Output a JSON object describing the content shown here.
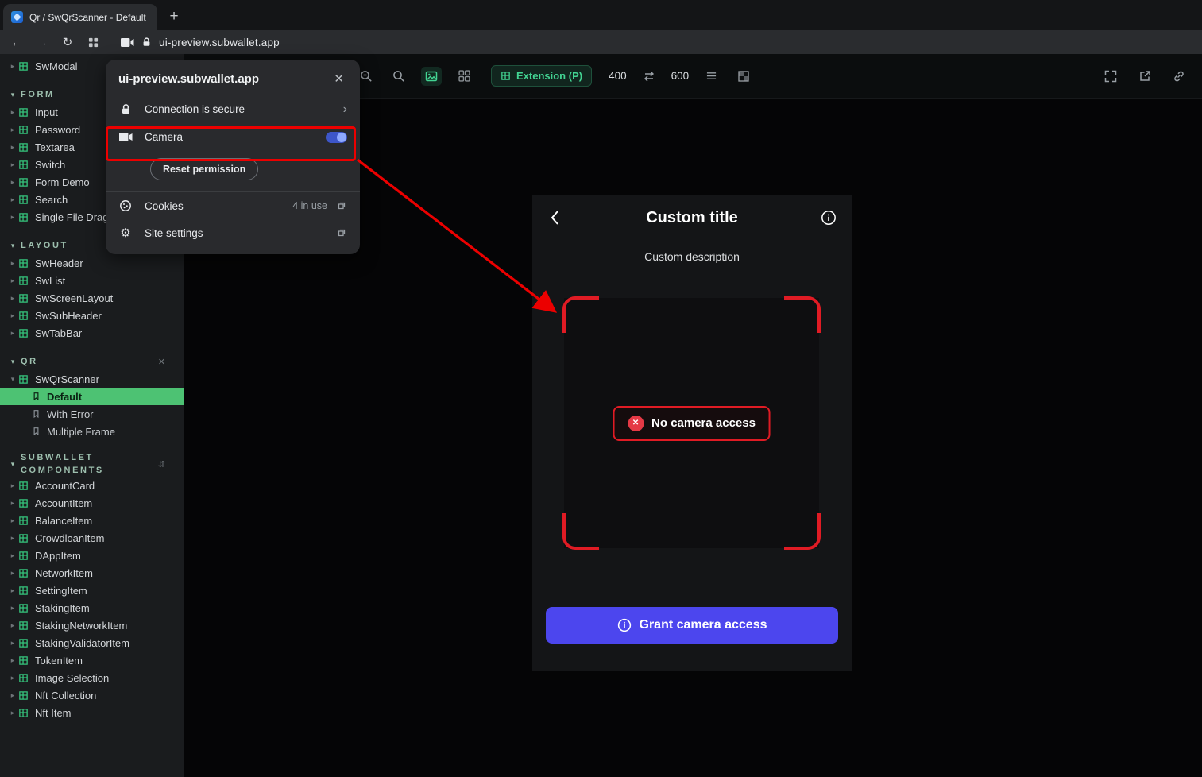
{
  "browser": {
    "tab_title": "Qr / SwQrScanner - Default · S",
    "new_tab_label": "+",
    "url": "ui-preview.subwallet.app"
  },
  "popup": {
    "title": "ui-preview.subwallet.app",
    "close_glyph": "✕",
    "connection_label": "Connection is secure",
    "camera_label": "Camera",
    "camera_toggle_state": "on",
    "reset_button_label": "Reset permission",
    "cookies_label": "Cookies",
    "cookies_count": "4 in use",
    "site_settings_label": "Site settings"
  },
  "sidebar": {
    "sections": [
      {
        "title": "",
        "components": [
          {
            "name": "SwModal"
          }
        ]
      },
      {
        "title": "FORM",
        "components": [
          {
            "name": "Input"
          },
          {
            "name": "Password"
          },
          {
            "name": "Textarea"
          },
          {
            "name": "Switch"
          },
          {
            "name": "Form Demo"
          },
          {
            "name": "Search"
          },
          {
            "name": "Single File Drag"
          }
        ]
      },
      {
        "title": "LAYOUT",
        "components": [
          {
            "name": "SwHeader"
          },
          {
            "name": "SwList"
          },
          {
            "name": "SwScreenLayout"
          },
          {
            "name": "SwSubHeader"
          },
          {
            "name": "SwTabBar"
          }
        ]
      },
      {
        "title": "QR",
        "header_action": "close",
        "components": [
          {
            "name": "SwQrScanner",
            "expanded": true,
            "variants": [
              {
                "name": "Default",
                "selected": true
              },
              {
                "name": "With Error",
                "selected": false
              },
              {
                "name": "Multiple Frame",
                "selected": false
              }
            ]
          }
        ]
      },
      {
        "title": "SUBWALLET COMPONENTS",
        "header_action": "sort",
        "components": [
          {
            "name": "AccountCard"
          },
          {
            "name": "AccountItem"
          },
          {
            "name": "BalanceItem"
          },
          {
            "name": "CrowdloanItem"
          },
          {
            "name": "DAppItem"
          },
          {
            "name": "NetworkItem"
          },
          {
            "name": "SettingItem"
          },
          {
            "name": "StakingItem"
          },
          {
            "name": "StakingNetworkItem"
          },
          {
            "name": "StakingValidatorItem"
          },
          {
            "name": "TokenItem"
          },
          {
            "name": "Image Selection"
          },
          {
            "name": "Nft Collection"
          },
          {
            "name": "Nft Item"
          }
        ]
      }
    ]
  },
  "toolbar": {
    "mode_label": "Extension (P)",
    "width_value": "400",
    "height_value": "600"
  },
  "preview": {
    "title": "Custom title",
    "description": "Custom description",
    "no_access_label": "No camera access",
    "error_x_glyph": "✕",
    "grant_button_label": "Grant camera access"
  },
  "colors": {
    "accent_green": "#42d392",
    "selected_green": "#4dc273",
    "primary_blue": "#4c46ee",
    "error_red": "#e01b24",
    "annotation_red": "#ec0000"
  }
}
